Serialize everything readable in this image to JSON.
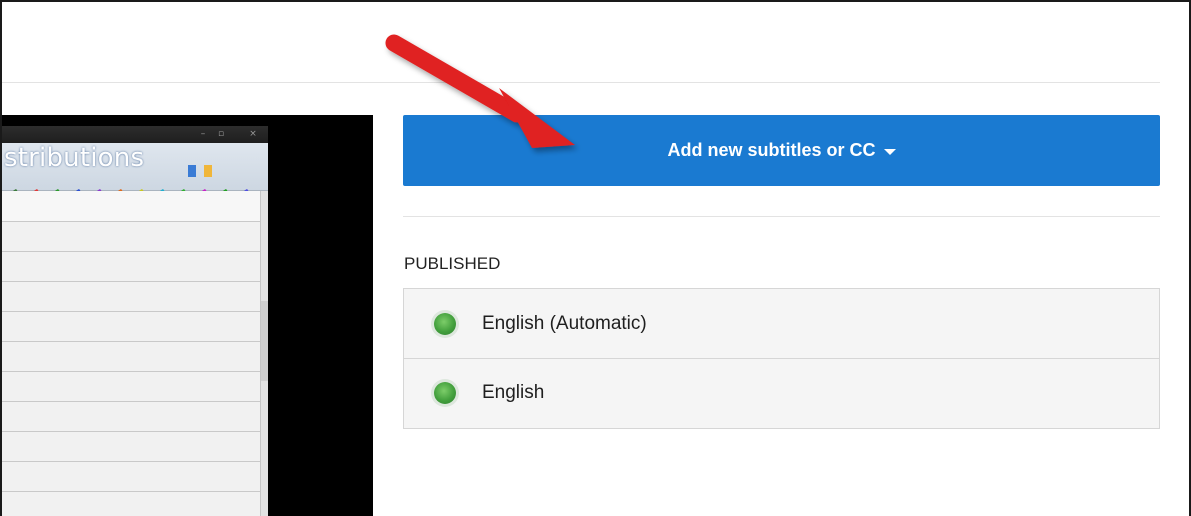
{
  "video_preview": {
    "window_title": "stributions",
    "pen_colors": [
      "#3a7a3a",
      "#e03a3a",
      "#2b9a2b",
      "#2a4fd0",
      "#8a3ad0",
      "#e06a1a",
      "#c8c820",
      "#20b0d0",
      "#30b030",
      "#c820c8",
      "#20a020",
      "#5050e0"
    ]
  },
  "captions_panel": {
    "add_button_label": "Add new subtitles or CC",
    "section_heading": "PUBLISHED",
    "tracks": [
      {
        "label": "English (Automatic)",
        "status_color": "#43a03d"
      },
      {
        "label": "English",
        "status_color": "#43a03d"
      }
    ]
  },
  "annotation": {
    "arrow_color": "#e02020"
  },
  "colors": {
    "accent": "#1a7ad1"
  }
}
